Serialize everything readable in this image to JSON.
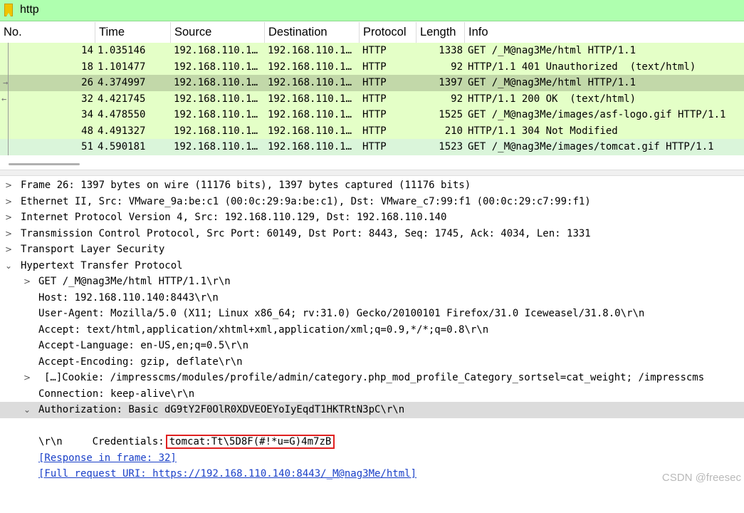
{
  "filter": {
    "value": "http",
    "icon": "bookmark-icon"
  },
  "columns": [
    "No.",
    "Time",
    "Source",
    "Destination",
    "Protocol",
    "Length",
    "Info"
  ],
  "packets": [
    {
      "no": "14",
      "time": "1.035146",
      "src": "192.168.110.1…",
      "dst": "192.168.110.1…",
      "proto": "HTTP",
      "len": "1338",
      "info": "GET /_M@nag3Me/html HTTP/1.1"
    },
    {
      "no": "18",
      "time": "1.101477",
      "src": "192.168.110.1…",
      "dst": "192.168.110.1…",
      "proto": "HTTP",
      "len": "92",
      "info": "HTTP/1.1 401 Unauthorized  (text/html)"
    },
    {
      "no": "26",
      "time": "4.374997",
      "src": "192.168.110.1…",
      "dst": "192.168.110.1…",
      "proto": "HTTP",
      "len": "1397",
      "info": "GET /_M@nag3Me/html HTTP/1.1"
    },
    {
      "no": "32",
      "time": "4.421745",
      "src": "192.168.110.1…",
      "dst": "192.168.110.1…",
      "proto": "HTTP",
      "len": "92",
      "info": "HTTP/1.1 200 OK  (text/html)"
    },
    {
      "no": "34",
      "time": "4.478550",
      "src": "192.168.110.1…",
      "dst": "192.168.110.1…",
      "proto": "HTTP",
      "len": "1525",
      "info": "GET /_M@nag3Me/images/asf-logo.gif HTTP/1.1"
    },
    {
      "no": "48",
      "time": "4.491327",
      "src": "192.168.110.1…",
      "dst": "192.168.110.1…",
      "proto": "HTTP",
      "len": "210",
      "info": "HTTP/1.1 304 Not Modified"
    },
    {
      "no": "51",
      "time": "4.590181",
      "src": "192.168.110.1…",
      "dst": "192.168.110.1…",
      "proto": "HTTP",
      "len": "1523",
      "info": "GET /_M@nag3Me/images/tomcat.gif HTTP/1.1"
    }
  ],
  "colors": {
    "row_bg": "#e4ffc7",
    "row_selected": "#c2d8a9",
    "filter_bg": "#afffaf",
    "highlight_box": "#e02020",
    "link": "#1a40c8"
  },
  "details": {
    "frame": "Frame 26: 1397 bytes on wire (11176 bits), 1397 bytes captured (11176 bits)",
    "ethernet": "Ethernet II, Src: VMware_9a:be:c1 (00:0c:29:9a:be:c1), Dst: VMware_c7:99:f1 (00:0c:29:c7:99:f1)",
    "ip": "Internet Protocol Version 4, Src: 192.168.110.129, Dst: 192.168.110.140",
    "tcp": "Transmission Control Protocol, Src Port: 60149, Dst Port: 8443, Seq: 1745, Ack: 4034, Len: 1331",
    "tls": "Transport Layer Security",
    "http": "Hypertext Transfer Protocol",
    "request_line": "GET /_M@nag3Me/html HTTP/1.1\\r\\n",
    "host": "Host: 192.168.110.140:8443\\r\\n",
    "user_agent": "User-Agent: Mozilla/5.0 (X11; Linux x86_64; rv:31.0) Gecko/20100101 Firefox/31.0 Iceweasel/31.8.0\\r\\n",
    "accept": "Accept: text/html,application/xhtml+xml,application/xml;q=0.9,*/*;q=0.8\\r\\n",
    "accept_language": "Accept-Language: en-US,en;q=0.5\\r\\n",
    "accept_encoding": "Accept-Encoding: gzip, deflate\\r\\n",
    "cookie": "[…]Cookie: /impresscms/modules/profile/admin/category.php_mod_profile_Category_sortsel=cat_weight; /impresscms",
    "connection": "Connection: keep-alive\\r\\n",
    "authorization": "Authorization: Basic dG9tY2F0OlR0XDVEOEYoIyEqdT1HKTRtN3pC\\r\\n",
    "credentials_label": "Credentials:",
    "credentials_value": "tomcat:Tt\\5D8F(#!*u=G)4m7zB",
    "crlf": "\\r\\n",
    "response_in_frame": "[Response in frame: 32]",
    "full_request_uri": "[Full request URI: https://192.168.110.140:8443/_M@nag3Me/html]"
  },
  "watermark": "CSDN @freesec"
}
